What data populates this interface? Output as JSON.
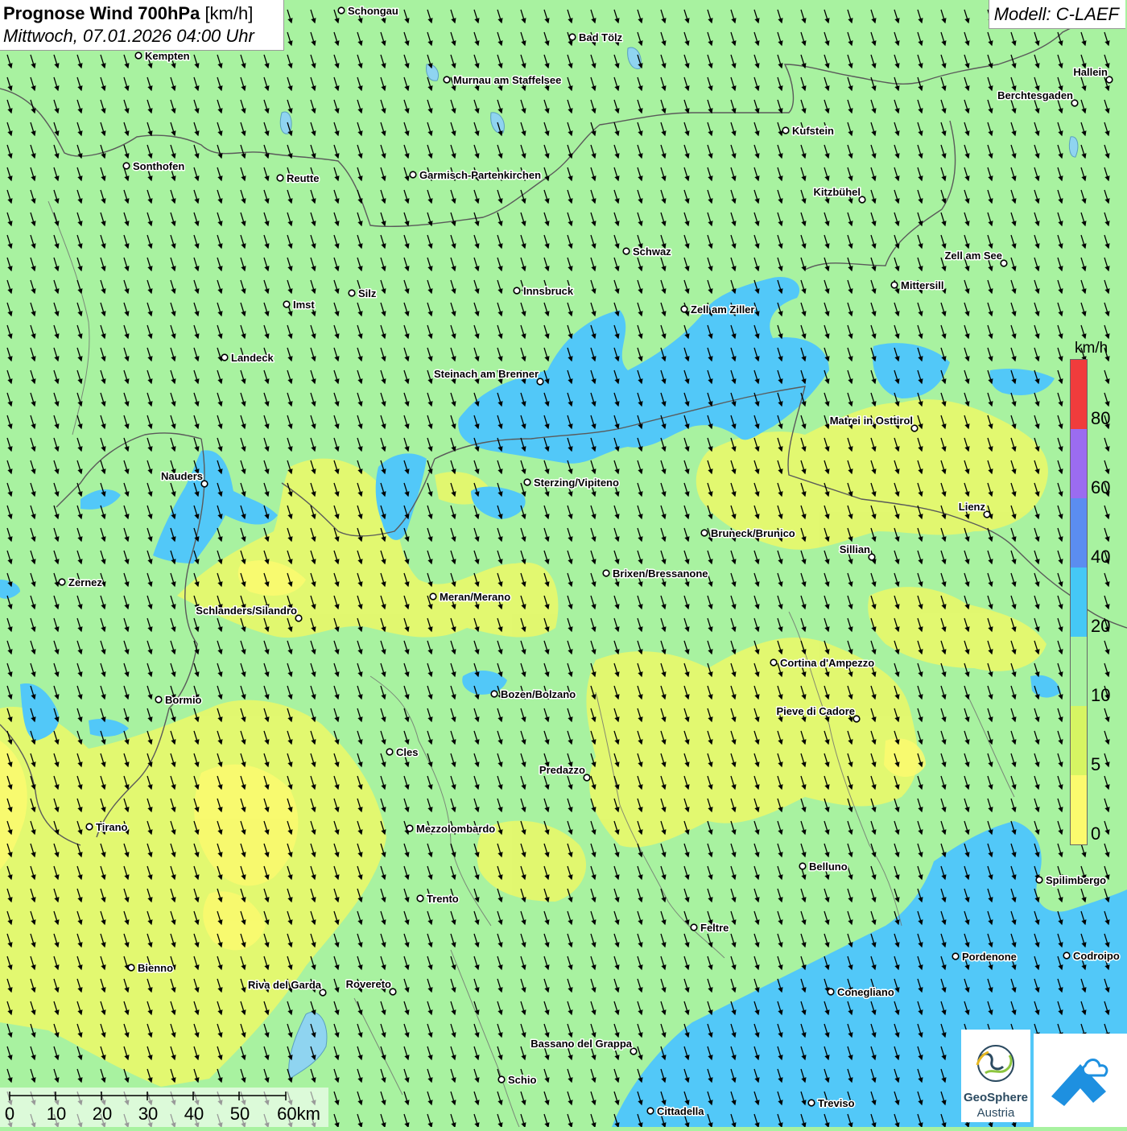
{
  "header": {
    "title_bold": "Prognose Wind 700hPa",
    "title_unit": "[km/h]",
    "datetime": "Mittwoch, 07.01.2026 04:00 Uhr",
    "model": "Modell: C-LAEF"
  },
  "legend": {
    "unit": "km/h",
    "labels": [
      "80",
      "60",
      "40",
      "20",
      "10",
      "5",
      "0"
    ],
    "colors": [
      "#f03c3c",
      "#9b6cf0",
      "#5b8df0",
      "#45c8f5",
      "#a8f2a0",
      "#d6f563",
      "#fbfa6e"
    ]
  },
  "map": {
    "wind_direction": "north-northwest to south-southeast (arrows pointing down)",
    "field_colors": {
      "low": "#fbfa6e",
      "mid": "#d6f563",
      "default": "#a8f2a0",
      "high": "#52c8f8"
    },
    "cities": [
      {
        "name": "Schongau"
      },
      {
        "name": "Kempten"
      },
      {
        "name": "Bad Tölz"
      },
      {
        "name": "Murnau am Staffelsee"
      },
      {
        "name": "Hallein"
      },
      {
        "name": "Berchtesgaden"
      },
      {
        "name": "Kufstein"
      },
      {
        "name": "Sonthofen"
      },
      {
        "name": "Reutte"
      },
      {
        "name": "Garmisch-Partenkirchen"
      },
      {
        "name": "Kitzbühel"
      },
      {
        "name": "Schwaz"
      },
      {
        "name": "Zell am See"
      },
      {
        "name": "Mittersill"
      },
      {
        "name": "Imst"
      },
      {
        "name": "Silz"
      },
      {
        "name": "Innsbruck"
      },
      {
        "name": "Zell am Ziller"
      },
      {
        "name": "Landeck"
      },
      {
        "name": "Steinach am Brenner"
      },
      {
        "name": "Matrei in Osttirol"
      },
      {
        "name": "Nauders"
      },
      {
        "name": "Sterzing/Vipiteno"
      },
      {
        "name": "Lienz"
      },
      {
        "name": "Bruneck/Brunico"
      },
      {
        "name": "Sillian"
      },
      {
        "name": "Brixen/Bressanone"
      },
      {
        "name": "Zernez"
      },
      {
        "name": "Meran/Merano"
      },
      {
        "name": "Schlanders/Silandro"
      },
      {
        "name": "Cortina d'Ampezzo"
      },
      {
        "name": "Bozen/Bolzano"
      },
      {
        "name": "Bormio"
      },
      {
        "name": "Pieve di Cadore"
      },
      {
        "name": "Cles"
      },
      {
        "name": "Predazzo"
      },
      {
        "name": "Tirano"
      },
      {
        "name": "Mezzolombardo"
      },
      {
        "name": "Belluno"
      },
      {
        "name": "Spilimbergo"
      },
      {
        "name": "Trento"
      },
      {
        "name": "Feltre"
      },
      {
        "name": "Bienno"
      },
      {
        "name": "Pordenone"
      },
      {
        "name": "Codroipo"
      },
      {
        "name": "Riva del Garda"
      },
      {
        "name": "Rovereto"
      },
      {
        "name": "Conegliano"
      },
      {
        "name": "Bassano del Grappa"
      },
      {
        "name": "Schio"
      },
      {
        "name": "Treviso"
      },
      {
        "name": "Cittadella"
      }
    ]
  },
  "scalebar": {
    "labels": [
      "0",
      "10",
      "20",
      "30",
      "40",
      "50",
      "60km"
    ]
  },
  "logo": {
    "line1": "GeoSphere",
    "line2": "Austria"
  }
}
